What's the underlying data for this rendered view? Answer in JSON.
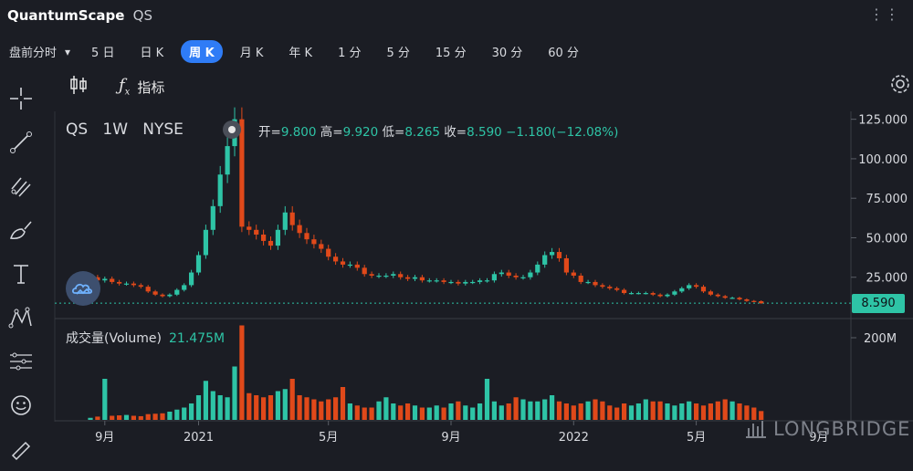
{
  "header": {
    "company": "QuantumScape",
    "ticker": "QS",
    "more_icon": "ellipsis-icon"
  },
  "periods": [
    {
      "label": "盘前分时",
      "has_dropdown": true,
      "active": false
    },
    {
      "label": "5 日",
      "active": false
    },
    {
      "label": "日 K",
      "active": false
    },
    {
      "label": "周 K",
      "active": true
    },
    {
      "label": "月 K",
      "active": false
    },
    {
      "label": "年 K",
      "active": false
    },
    {
      "label": "1 分",
      "active": false
    },
    {
      "label": "5 分",
      "active": false
    },
    {
      "label": "15 分",
      "active": false
    },
    {
      "label": "30 分",
      "active": false
    },
    {
      "label": "60 分",
      "active": false
    }
  ],
  "toolbar": {
    "candle_icon": "candlestick-icon",
    "fx_icon": "function-icon",
    "indicator_label": "指标",
    "settings_icon": "gear-icon"
  },
  "sidebar_tools": [
    "crosshair-icon",
    "trend-line-icon",
    "fib-channel-icon",
    "brush-icon",
    "text-tool-icon",
    "pattern-icon",
    "measure-icon",
    "emoji-icon",
    "ruler-icon"
  ],
  "chart_info": {
    "symbol": "QS",
    "interval": "1W",
    "exchange": "NYSE",
    "open_label": "开=",
    "open": "9.800",
    "high_label": "高=",
    "high": "9.920",
    "low_label": "低=",
    "low": "8.265",
    "close_label": "收=",
    "close": "8.590",
    "change": "−1.180",
    "change_pct": "(−12.08%)"
  },
  "volume_info": {
    "label": "成交量(Volume)",
    "value": "21.475M"
  },
  "brand": "LONGBRIDGE",
  "colors": {
    "up": "#2ec4a6",
    "down": "#e0491a",
    "background": "#1b1d24",
    "active_tab": "#2f7cf6"
  },
  "chart_data": {
    "type": "candlestick",
    "price_axis": {
      "ticks": [
        25,
        50,
        75,
        100,
        125
      ],
      "labels": [
        "25.000",
        "50.000",
        "75.000",
        "100.000",
        "125.000"
      ],
      "range": [
        0,
        130
      ]
    },
    "volume_axis": {
      "ticks": [
        200
      ],
      "labels": [
        "200M"
      ],
      "unit": "M",
      "range": [
        0,
        240
      ]
    },
    "last_price": 8.59,
    "last_price_label": "8.590",
    "x_tick_labels": [
      "9月",
      "2021",
      "5月",
      "9月",
      "2022",
      "5月",
      "9月"
    ],
    "x_tick_weeks": [
      2,
      15,
      33,
      50,
      67,
      84,
      101
    ],
    "weekly_close": [
      25,
      23,
      24,
      22,
      21,
      21,
      20,
      19,
      16,
      14,
      13,
      14,
      17,
      20,
      28,
      39,
      55,
      70,
      90,
      108,
      125,
      57,
      55,
      52,
      48,
      45,
      55,
      66,
      58,
      53,
      49,
      46,
      43,
      38,
      35,
      33,
      33,
      31,
      27,
      26,
      26,
      26,
      27,
      25,
      24,
      25,
      23,
      23,
      23,
      22,
      22,
      21,
      22,
      22,
      23,
      23,
      27,
      28,
      26,
      25,
      25,
      28,
      33,
      39,
      41,
      37,
      28,
      26,
      22,
      22,
      20,
      19,
      18,
      17,
      15,
      15,
      15,
      15,
      14,
      13,
      14,
      16,
      18,
      20,
      19,
      16,
      14,
      13,
      12,
      12,
      11,
      10,
      9.8,
      8.59
    ],
    "weekly_volume": [
      5,
      8,
      100,
      10,
      11,
      12,
      10,
      9,
      14,
      15,
      16,
      20,
      25,
      30,
      40,
      60,
      95,
      70,
      60,
      55,
      130,
      230,
      65,
      60,
      55,
      60,
      70,
      75,
      100,
      60,
      55,
      50,
      45,
      50,
      55,
      80,
      40,
      35,
      30,
      30,
      45,
      55,
      40,
      35,
      40,
      35,
      30,
      30,
      35,
      30,
      40,
      45,
      35,
      30,
      40,
      100,
      45,
      35,
      40,
      55,
      50,
      45,
      45,
      50,
      60,
      45,
      40,
      35,
      40,
      45,
      50,
      45,
      35,
      30,
      40,
      35,
      40,
      50,
      45,
      45,
      40,
      35,
      40,
      45,
      40,
      35,
      40,
      45,
      50,
      45,
      40,
      35,
      30,
      21.475
    ]
  }
}
